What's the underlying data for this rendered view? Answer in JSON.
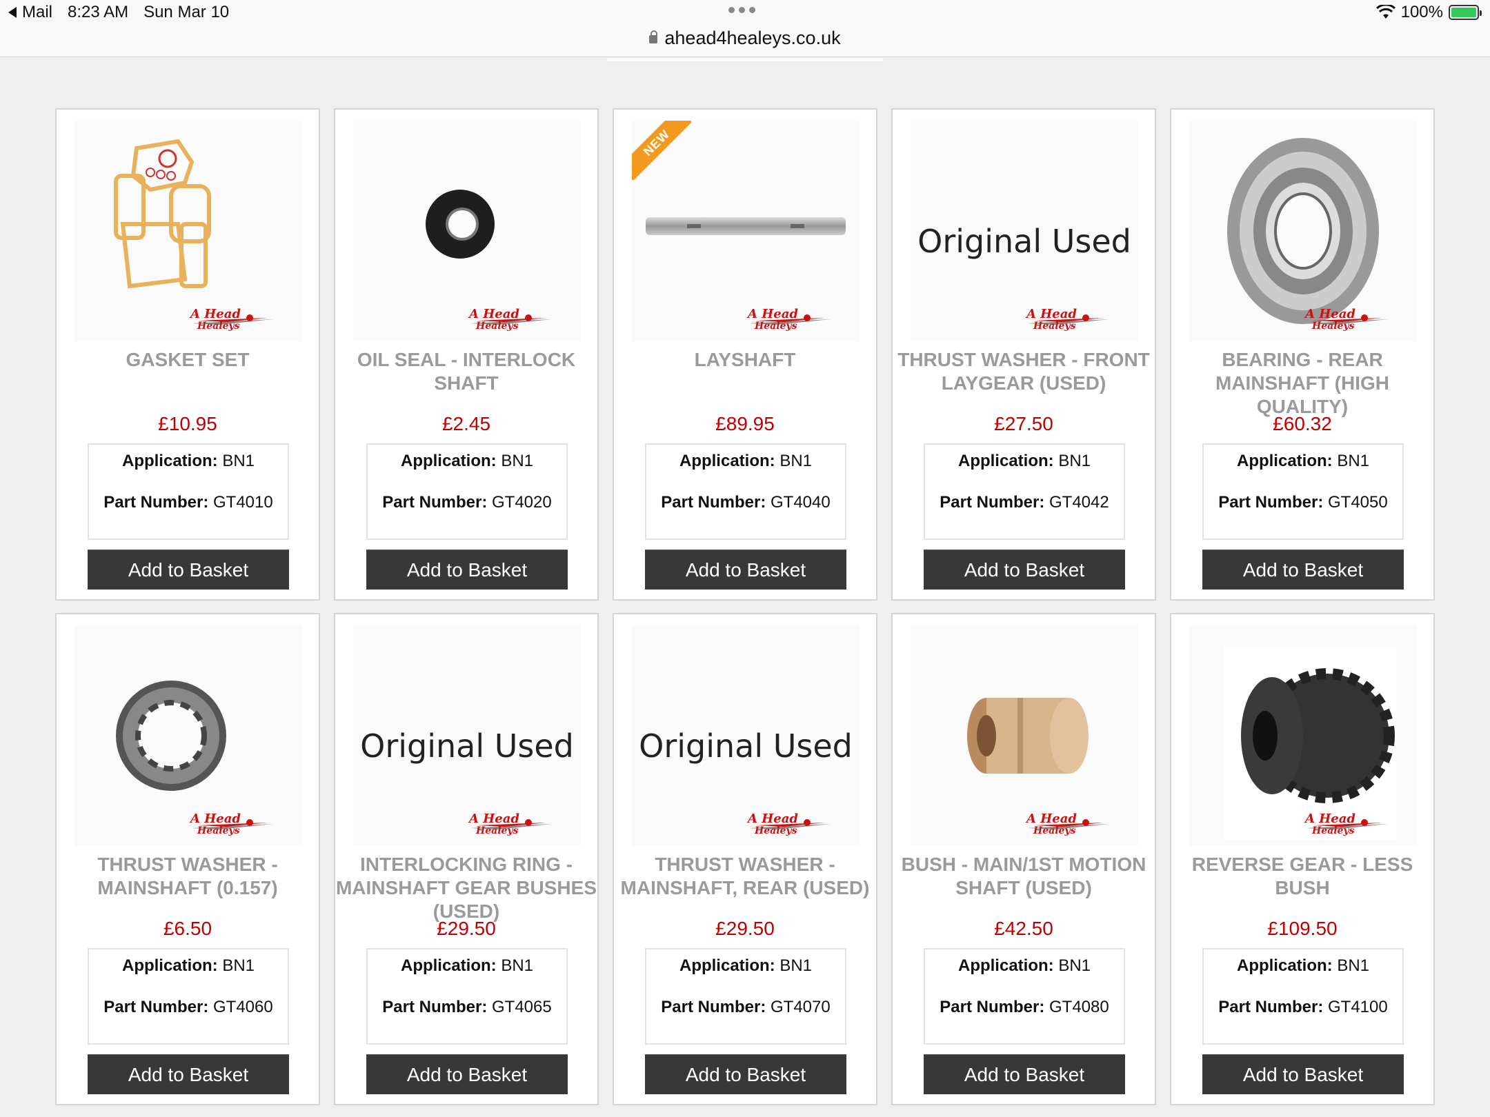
{
  "status": {
    "back_app": "Mail",
    "time": "8:23 AM",
    "date": "Sun Mar 10",
    "battery": "100%"
  },
  "browser": {
    "url": "ahead4healeys.co.uk"
  },
  "labels": {
    "application": "Application:",
    "part_number": "Part Number:",
    "add_to_basket": "Add to Basket",
    "original_used": "Original Used",
    "new_badge": "NEW"
  },
  "products": [
    {
      "title": "GASKET SET",
      "price": "£10.95",
      "application": "BN1",
      "part": "GT4010",
      "image": "gasket-set-image"
    },
    {
      "title": "OIL SEAL - INTERLOCK SHAFT",
      "price": "£2.45",
      "application": "BN1",
      "part": "GT4020",
      "image": "oil-seal-image"
    },
    {
      "title": "LAYSHAFT",
      "price": "£89.95",
      "application": "BN1",
      "part": "GT4040",
      "image": "layshaft-image",
      "badge": "NEW"
    },
    {
      "title": "THRUST WASHER - FRONT LAYGEAR (USED)",
      "price": "£27.50",
      "application": "BN1",
      "part": "GT4042",
      "image": "original-used"
    },
    {
      "title": "BEARING - REAR MAINSHAFT (HIGH QUALITY)",
      "price": "£60.32",
      "application": "BN1",
      "part": "GT4050",
      "image": "bearing-image"
    },
    {
      "title": "THRUST WASHER - MAINSHAFT (0.157)",
      "price": "£6.50",
      "application": "BN1",
      "part": "GT4060",
      "image": "thrust-washer-image"
    },
    {
      "title": "INTERLOCKING RING - MAINSHAFT GEAR BUSHES (USED)",
      "price": "£29.50",
      "application": "BN1",
      "part": "GT4065",
      "image": "original-used"
    },
    {
      "title": "THRUST WASHER - MAINSHAFT, REAR (USED)",
      "price": "£29.50",
      "application": "BN1",
      "part": "GT4070",
      "image": "original-used"
    },
    {
      "title": "BUSH - MAIN/1ST MOTION SHAFT (USED)",
      "price": "£42.50",
      "application": "BN1",
      "part": "GT4080",
      "image": "bush-image"
    },
    {
      "title": "REVERSE GEAR - LESS BUSH",
      "price": "£109.50",
      "application": "BN1",
      "part": "GT4100",
      "image": "reverse-gear-image"
    }
  ]
}
